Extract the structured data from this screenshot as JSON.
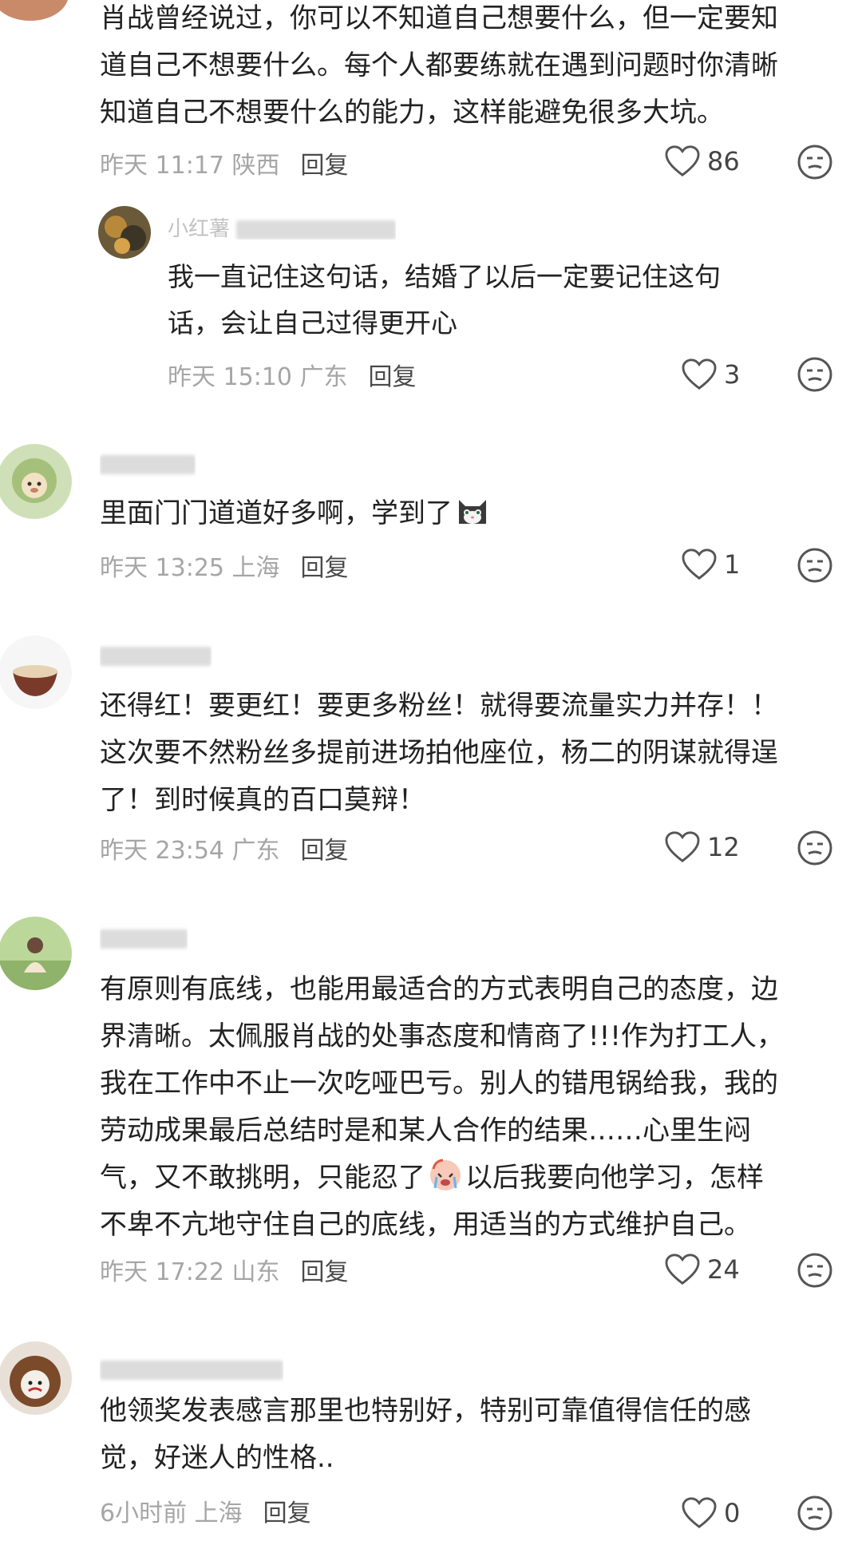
{
  "comments": [
    {
      "text": "肖战曾经说过，你可以不知道自己想要什么，但一定要知\n道自己不想要什么。每个人都要练就在遇到问题时你清晰\n知道自己不想要什么的能力，这样能避免很多大坑。",
      "time": "昨天 11:17 陕西",
      "reply_label": "回复",
      "likes": "86"
    },
    {
      "username": "小红薯",
      "text": "我一直记住这句话，结婚了以后一定要记住这句\n话，会让自己过得更开心",
      "time": "昨天 15:10 广东",
      "reply_label": "回复",
      "likes": "3"
    },
    {
      "text_before": "里面门门道道好多啊，学到了",
      "emoji": "cat-emoji",
      "time": "昨天 13:25 上海",
      "reply_label": "回复",
      "likes": "1"
    },
    {
      "text": "还得红！要更红！要更多粉丝！就得要流量实力并存！！\n这次要不然粉丝多提前进场拍他座位，杨二的阴谋就得逞\n了！到时候真的百口莫辩！",
      "time": "昨天 23:54 广东",
      "reply_label": "回复",
      "likes": "12"
    },
    {
      "text_before": "有原则有底线，也能用最适合的方式表明自己的态度，边\n界清晰。太佩服肖战的处事态度和情商了!!!作为打工人，\n我在工作中不止一次吃哑巴亏。别人的错甩锅给我，我的\n劳动成果最后总结时是和某人合作的结果……心里生闷\n气，又不敢挑明，只能忍了",
      "emoji": "crying-emoji",
      "text_after": "以后我要向他学习，怎样\n不卑不亢地守住自己的底线，用适当的方式维护自己。",
      "time": "昨天 17:22 山东",
      "reply_label": "回复",
      "likes": "24"
    },
    {
      "text": "他领奖发表感言那里也特别好，特别可靠值得信任的感\n觉，好迷人的性格..",
      "time": "6小时前 上海",
      "reply_label": "回复",
      "likes": "0"
    }
  ],
  "colors": {
    "text": "#222222",
    "meta": "#a6a6a6",
    "reply": "#4a4a4a",
    "icon": "#555555"
  },
  "icons": {
    "like": "heart-outline-icon",
    "dislike": "unamused-face-icon"
  }
}
